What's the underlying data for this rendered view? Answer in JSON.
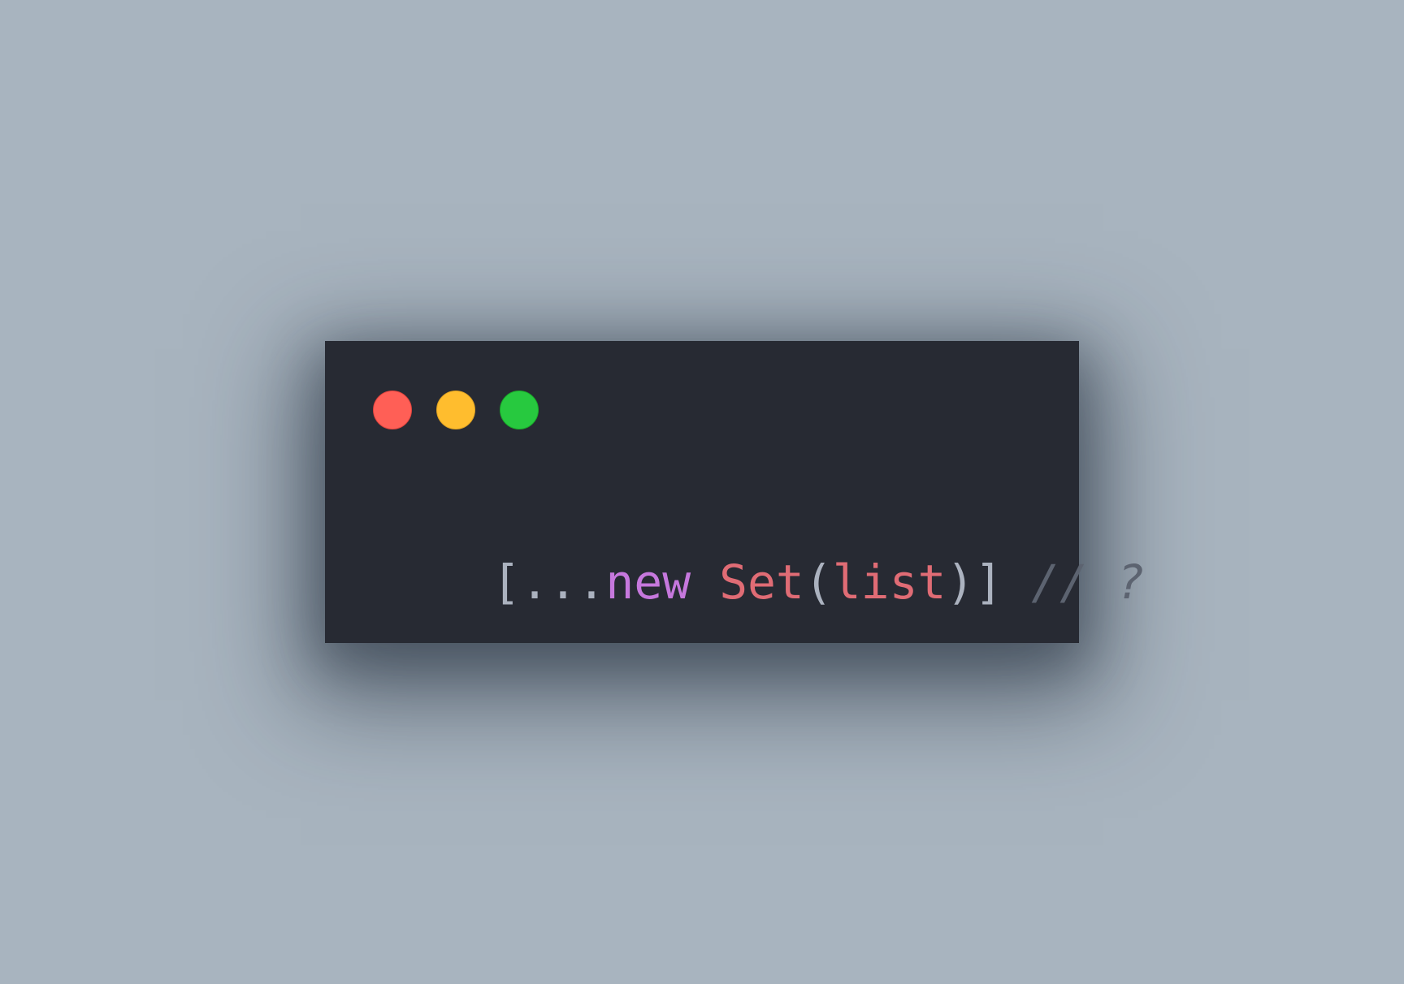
{
  "window": {
    "controls": [
      {
        "name": "close",
        "color": "#ff5f56"
      },
      {
        "name": "minimize",
        "color": "#ffbd2e"
      },
      {
        "name": "maximize",
        "color": "#27c93f"
      }
    ]
  },
  "code": {
    "tokens": [
      {
        "text": "[",
        "color": "#abb2bf",
        "role": "punctuation"
      },
      {
        "text": "...",
        "color": "#abb2bf",
        "role": "operator"
      },
      {
        "text": "new",
        "color": "#c678dd",
        "role": "keyword"
      },
      {
        "text": " ",
        "color": "#abb2bf",
        "role": "space"
      },
      {
        "text": "Set",
        "color": "#e06c75",
        "role": "class"
      },
      {
        "text": "(",
        "color": "#abb2bf",
        "role": "punctuation"
      },
      {
        "text": "list",
        "color": "#e06c75",
        "role": "identifier"
      },
      {
        "text": ")",
        "color": "#abb2bf",
        "role": "punctuation"
      },
      {
        "text": "]",
        "color": "#abb2bf",
        "role": "punctuation"
      },
      {
        "text": " ",
        "color": "#abb2bf",
        "role": "space"
      },
      {
        "text": "// ?",
        "color": "#5c6370",
        "role": "comment"
      }
    ]
  },
  "colors": {
    "background": "#a8b4bf",
    "window_background": "#272a33"
  }
}
